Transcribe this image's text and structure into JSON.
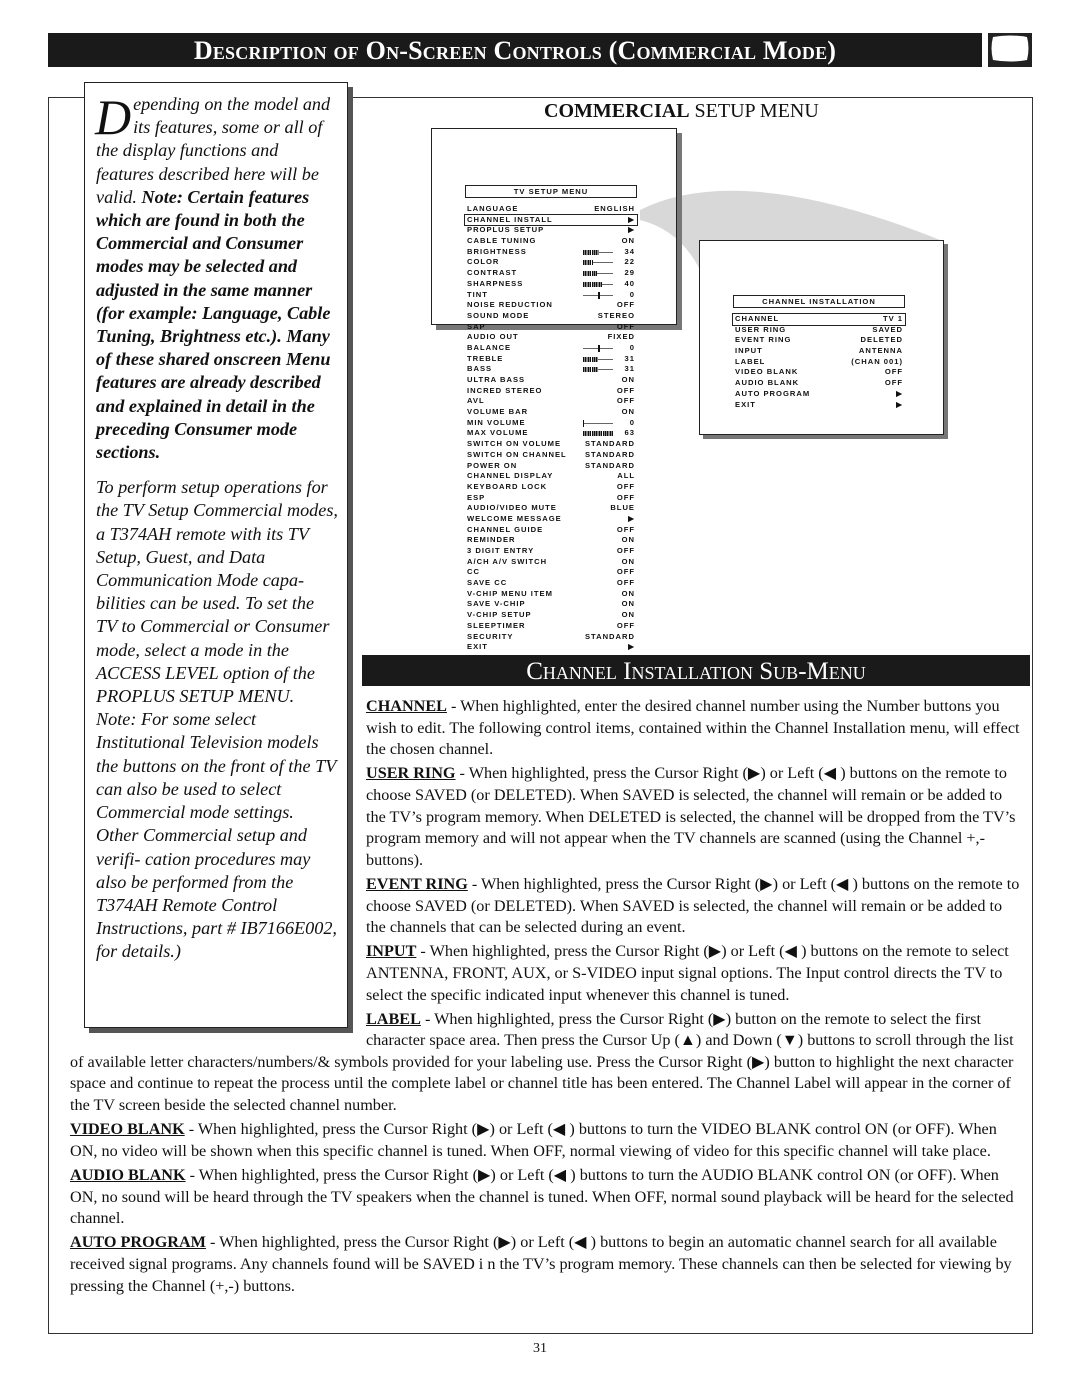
{
  "header": {
    "title": "Description of On-Screen Controls (Commercial Mode)",
    "icon": "tv-screen-icon"
  },
  "sidebar": {
    "dropcap": "D",
    "p1_normal": "epending on the model and its features, some or all of the display functions and features described here will be valid. ",
    "p1_bold": "Note: Certain features which are found in both the Commercial and Consumer modes may be selected and adjusted in the same manner (for example: Language, Cable Tuning, Brightness etc.). Many of these shared onscreen Menu features are already described and explained in detail in the preceding Consumer mode sections.",
    "p2": "To perform setup operations for the TV Setup Commercial modes, a T374AH remote with its TV Setup, Guest, and Data Communication Mode capa- bilities can be used. To set the TV to Commercial or Consumer mode, select a mode in the ACCESS LEVEL option of the PROPLUS SETUP MENU. Note: For some select Institutional Television models the buttons on the front of the TV can also be used to select Commercial mode settings. Other Commercial setup and verifi- cation procedures may also be performed from the T374AH Remote Control Instructions, part # IB7166E002, for details.)"
  },
  "section_title": {
    "bold": "COMMERCIAL",
    "rest": " SETUP MENU"
  },
  "tv_menu": {
    "title": "TV SETUP MENU",
    "highlighted": 1,
    "rows": [
      {
        "label": "LANGUAGE",
        "value": "ENGLISH"
      },
      {
        "label": "CHANNEL INSTALL",
        "value": "▶"
      },
      {
        "label": "PROPLUS SETUP",
        "value": "▶"
      },
      {
        "label": "CABLE TUNING",
        "value": "ON"
      },
      {
        "label": "BRIGHTNESS",
        "value": "34",
        "slider": "bar"
      },
      {
        "label": "COLOR",
        "value": "22",
        "slider": "bar"
      },
      {
        "label": "CONTRAST",
        "value": "29",
        "slider": "bar"
      },
      {
        "label": "SHARPNESS",
        "value": "40",
        "slider": "bar"
      },
      {
        "label": "TINT",
        "value": "0",
        "slider": "center"
      },
      {
        "label": "NOISE REDUCTION",
        "value": "OFF"
      },
      {
        "label": "SOUND MODE",
        "value": "STEREO"
      },
      {
        "label": "SAP",
        "value": "OFF"
      },
      {
        "label": "AUDIO OUT",
        "value": "FIXED"
      },
      {
        "label": "BALANCE",
        "value": "0",
        "slider": "center"
      },
      {
        "label": "TREBLE",
        "value": "31",
        "slider": "bar"
      },
      {
        "label": "BASS",
        "value": "31",
        "slider": "bar"
      },
      {
        "label": "ULTRA BASS",
        "value": "ON"
      },
      {
        "label": "INCRED STEREO",
        "value": "OFF"
      },
      {
        "label": "AVL",
        "value": "OFF"
      },
      {
        "label": "VOLUME BAR",
        "value": "ON"
      },
      {
        "label": "MIN VOLUME",
        "value": "0",
        "slider": "bar"
      },
      {
        "label": "MAX VOLUME",
        "value": "63",
        "slider": "bar"
      },
      {
        "label": "SWITCH ON VOLUME",
        "value": "STANDARD"
      },
      {
        "label": "SWITCH ON CHANNEL",
        "value": "STANDARD"
      },
      {
        "label": "POWER ON",
        "value": "STANDARD"
      },
      {
        "label": "CHANNEL DISPLAY",
        "value": "ALL"
      },
      {
        "label": "KEYBOARD LOCK",
        "value": "OFF"
      },
      {
        "label": "ESP",
        "value": "OFF"
      },
      {
        "label": "AUDIO/VIDEO MUTE",
        "value": "BLUE"
      },
      {
        "label": "WELCOME MESSAGE",
        "value": "▶"
      },
      {
        "label": "CHANNEL GUIDE",
        "value": "OFF"
      },
      {
        "label": "REMINDER",
        "value": "ON"
      },
      {
        "label": "3 DIGIT ENTRY",
        "value": "OFF"
      },
      {
        "label": "A/CH A/V SWITCH",
        "value": "ON"
      },
      {
        "label": "CC",
        "value": "OFF"
      },
      {
        "label": "SAVE CC",
        "value": "OFF"
      },
      {
        "label": "V-CHIP MENU ITEM",
        "value": "ON"
      },
      {
        "label": "SAVE V-CHIP",
        "value": "ON"
      },
      {
        "label": "V-CHIP SETUP",
        "value": "ON"
      },
      {
        "label": "SLEEPTIMER",
        "value": "OFF"
      },
      {
        "label": "SECURITY",
        "value": "STANDARD"
      },
      {
        "label": "EXIT",
        "value": "▶"
      }
    ]
  },
  "channel_menu": {
    "title": "CHANNEL INSTALLATION",
    "highlighted": 0,
    "rows": [
      {
        "label": "CHANNEL",
        "value": "TV   1"
      },
      {
        "label": "USER RING",
        "value": "SAVED"
      },
      {
        "label": "EVENT RING",
        "value": "DELETED"
      },
      {
        "label": "INPUT",
        "value": "ANTENNA"
      },
      {
        "label": "LABEL",
        "value": "(CHAN 001)"
      },
      {
        "label": "VIDEO BLANK",
        "value": "OFF"
      },
      {
        "label": "AUDIO BLANK",
        "value": "OFF"
      },
      {
        "label": "AUTO PROGRAM",
        "value": "▶"
      },
      {
        "label": "EXIT",
        "value": "▶"
      }
    ]
  },
  "submenu_title": "Channel Installation  Sub-Menu",
  "descriptions": [
    {
      "term": "CHANNEL",
      "text": " - When highlighted, enter the desired channel number using the Number buttons you wish to edit. The following control items, contained within the Channel Installation menu, will effect the chosen channel."
    },
    {
      "term": "USER RING",
      "text": " - When highlighted, press the Cursor Right (▶) or Left (◀ ) buttons on the remote to choose SAVED (or DELETED). When SAVED is selected, the channel will remain or be added to the TV’s program memory. When DELETED is selected, the channel will be dropped from the TV’s program memory and will not appear when the TV channels are scanned (using the Channel +,- buttons)."
    },
    {
      "term": "EVENT RING",
      "text": " - When highlighted, press the Cursor Right (▶) or Left (◀ ) buttons on the remote to choose SAVED (or DELETED). When SAVED is selected, the channel will remain or be added to the channels that can be selected during an event."
    },
    {
      "term": "INPUT",
      "text": " - When highlighted, press the Cursor Right (▶) or Left (◀ ) buttons on the remote to select ANTENNA, FRONT, AUX, or S-VIDEO input signal options. The Input control directs the TV to select the specific indicated input whenever this channel is tuned."
    },
    {
      "term": "LABEL",
      "text": " - When highlighted, press the Cursor Right (▶) button on the remote to select the first character space area. Then press the Cursor Up (▲) and Down (▼) buttons to scroll through the list of available letter characters/numbers/& symbols provided for your labeling use. Press the Cursor Right (▶) button to highlight the next character space and continue to repeat the process until the complete label or channel title has been entered. The Channel Label will appear in the corner of the TV screen beside the selected channel number."
    },
    {
      "term": "VIDEO BLANK",
      "text": " - When highlighted, press the Cursor Right (▶) or Left (◀ ) buttons to turn the VIDEO BLANK control ON (or OFF). When ON, no video will be shown when this specific channel is tuned. When OFF, normal viewing of video for this specific channel will take place."
    },
    {
      "term": "AUDIO BLANK",
      "text": " - When highlighted, press the Cursor Right (▶) or Left (◀ ) buttons to turn the AUDIO BLANK control ON (or OFF).  When ON, no sound will be heard through the TV speakers when the channel is tuned. When OFF, normal sound playback will be heard for the selected channel."
    },
    {
      "term": "AUTO PROGRAM",
      "text": " - When highlighted, press the Cursor Right (▶) or Left (◀ ) buttons to begin an automatic channel search for all available received signal programs. Any channels found will be SAVED i n the TV’s program memory. These channels can then be selected for viewing by pressing the Channel (+,-) buttons."
    }
  ],
  "page_number": "31"
}
